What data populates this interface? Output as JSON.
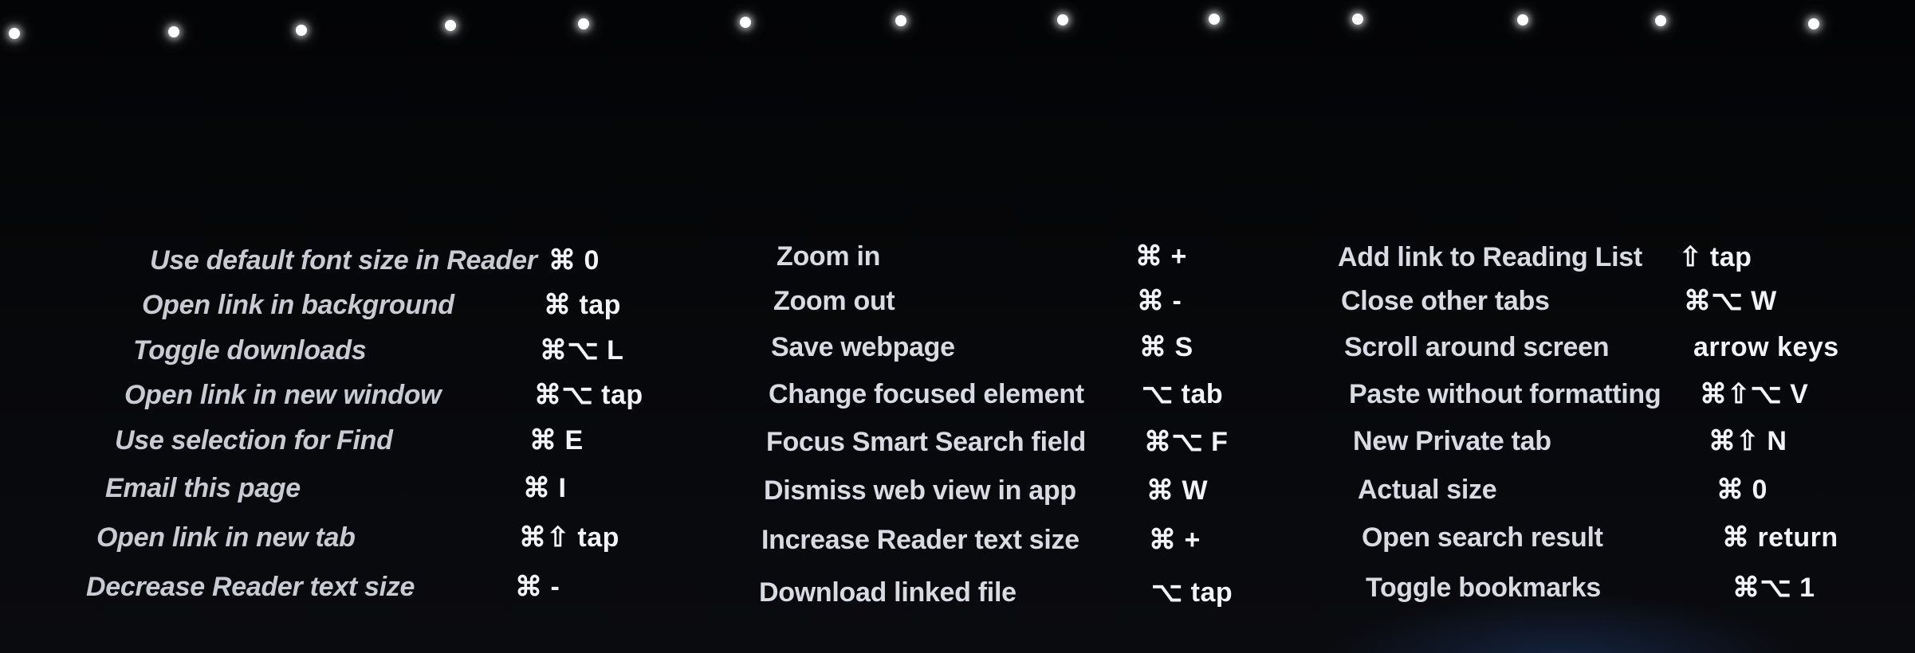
{
  "stage_lights": {
    "count": 13,
    "color": "#ffffff"
  },
  "background_color": "#06070a",
  "text_color": "#e2e4ea",
  "columns": [
    {
      "shortcuts": [
        {
          "action": "Use default font size in Reader",
          "keys": "⌘ 0"
        },
        {
          "action": "Open link in background",
          "keys": "⌘ tap"
        },
        {
          "action": "Toggle downloads",
          "keys": "⌘⌥ L"
        },
        {
          "action": "Open link in new window",
          "keys": "⌘⌥ tap"
        },
        {
          "action": "Use selection for Find",
          "keys": "⌘ E"
        },
        {
          "action": "Email this page",
          "keys": "⌘ I"
        },
        {
          "action": "Open link in new tab",
          "keys": "⌘⇧ tap"
        },
        {
          "action": "Decrease Reader text size",
          "keys": "⌘ -"
        }
      ]
    },
    {
      "shortcuts": [
        {
          "action": "Zoom in",
          "keys": "⌘ +"
        },
        {
          "action": "Zoom out",
          "keys": "⌘ -"
        },
        {
          "action": "Save webpage",
          "keys": "⌘ S"
        },
        {
          "action": "Change focused element",
          "keys": "⌥ tab"
        },
        {
          "action": "Focus Smart Search field",
          "keys": "⌘⌥ F"
        },
        {
          "action": "Dismiss web view in app",
          "keys": "⌘ W"
        },
        {
          "action": "Increase Reader text size",
          "keys": "⌘ +"
        },
        {
          "action": "Download linked file",
          "keys": "⌥ tap"
        }
      ]
    },
    {
      "shortcuts": [
        {
          "action": "Add link to Reading List",
          "keys": "⇧ tap"
        },
        {
          "action": "Close other tabs",
          "keys": "⌘⌥ W"
        },
        {
          "action": "Scroll around screen",
          "keys": "arrow keys"
        },
        {
          "action": "Paste without formatting",
          "keys": "⌘⇧⌥ V"
        },
        {
          "action": "New Private tab",
          "keys": "⌘⇧ N"
        },
        {
          "action": "Actual size",
          "keys": "⌘ 0"
        },
        {
          "action": "Open search result",
          "keys": "⌘ return"
        },
        {
          "action": "Toggle bookmarks",
          "keys": "⌘⌥ 1"
        }
      ]
    }
  ]
}
